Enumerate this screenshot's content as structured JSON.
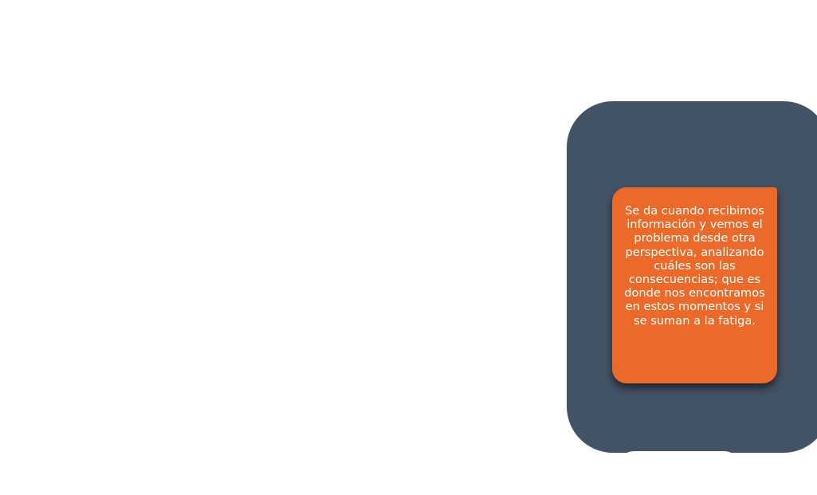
{
  "colors": {
    "background": "#ffffff",
    "panel": "#435366",
    "card": "#ec6a29",
    "card_text": "#ffffff"
  },
  "card": {
    "text": "Se da cuando recibimos información y vemos el problema desde otra perspectiva, analizando cuáles son las consecuencias; que es donde nos encontramos en estos momentos y si se suman a la fatiga."
  }
}
